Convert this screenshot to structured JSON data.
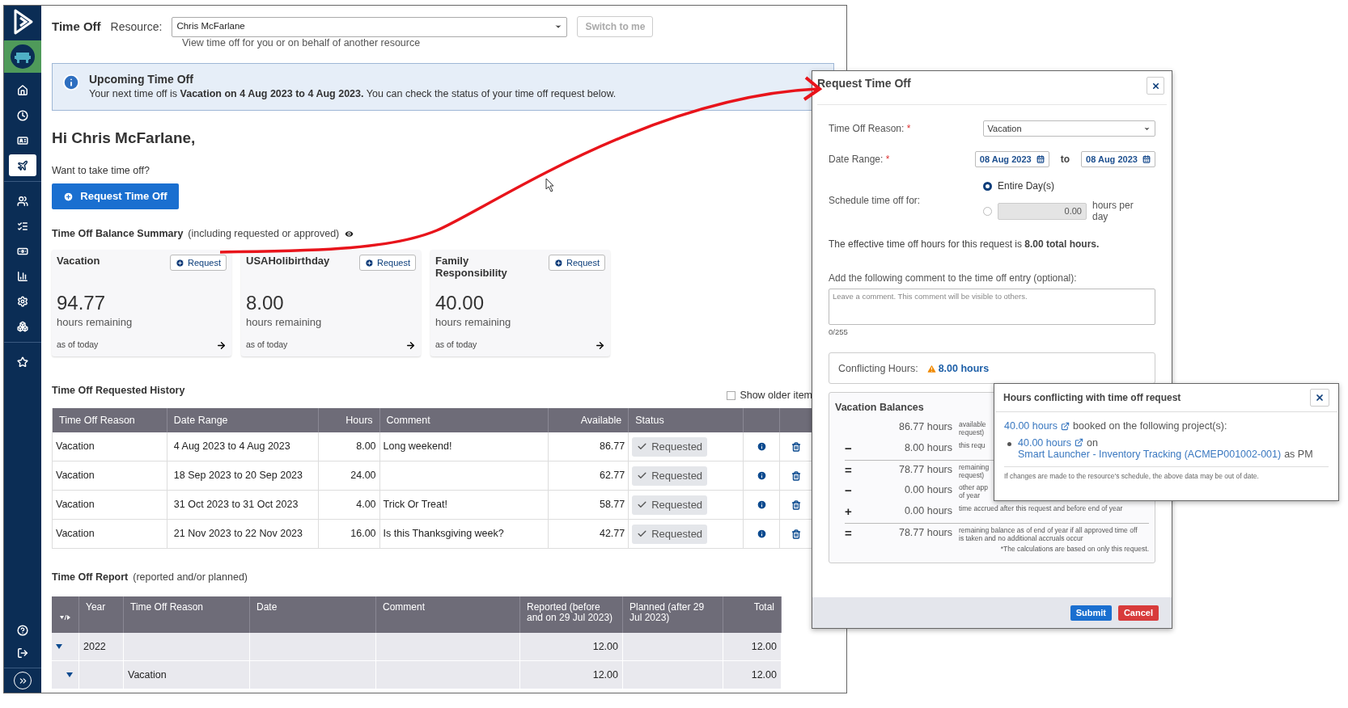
{
  "sidebar": {
    "items": [
      {
        "selected": false
      },
      {
        "selected": false
      },
      {
        "selected": false
      },
      {
        "selected": true
      },
      {
        "selected": false
      },
      {
        "selected": false
      },
      {
        "selected": false
      },
      {
        "selected": false
      },
      {
        "selected": false
      },
      {
        "selected": false
      },
      {
        "selected": false
      }
    ]
  },
  "header": {
    "title": "Time Off",
    "resource_label": "Resource:",
    "resource_value": "Chris McFarlane",
    "resource_hint": "View time off for you or on behalf of another resource",
    "switch_button": {
      "label": "Switch to me",
      "disabled": true
    }
  },
  "banner": {
    "title": "Upcoming Time Off",
    "text": "Your next time off is **Vacation on 4 Aug 2023 to 4 Aug 2023.** You can check the status of your time off request below."
  },
  "greeting": "Hi Chris McFarlane,",
  "prompt": "Want to take time off?",
  "request_button": "Request Time Off",
  "balance_summary": {
    "title": "Time Off Balance Summary",
    "note": "(including requested or approved)",
    "cards": [
      {
        "name": "Vacation",
        "request": "Request",
        "value": "94.77",
        "unit": "hours remaining",
        "as_of": "as of today"
      },
      {
        "name": "USAHolibirthday",
        "request": "Request",
        "value": "8.00",
        "unit": "hours remaining",
        "as_of": "as of today"
      },
      {
        "name": "Family Responsibility",
        "request": "Request",
        "value": "40.00",
        "unit": "hours remaining",
        "as_of": "as of today"
      }
    ]
  },
  "history": {
    "title": "Time Off Requested History",
    "show_older": {
      "label": "Show older item",
      "checked": false
    },
    "columns": [
      "Time Off Reason",
      "Date Range",
      "Hours",
      "Comment",
      "Available",
      "Status"
    ],
    "rows": [
      {
        "reason": "Vacation",
        "date_range": "4 Aug 2023 to 4 Aug 2023",
        "hours": "8.00",
        "comment": "Long weekend!",
        "available": "86.77",
        "status": "Requested"
      },
      {
        "reason": "Vacation",
        "date_range": "18 Sep 2023 to 20 Sep 2023",
        "hours": "24.00",
        "available": "62.77",
        "status": "Requested"
      },
      {
        "reason": "Vacation",
        "date_range": "31 Oct 2023 to 31 Oct 2023",
        "hours": "4.00",
        "comment": "Trick Or Treat!",
        "available": "58.77",
        "status": "Requested"
      },
      {
        "reason": "Vacation",
        "date_range": "21 Nov 2023 to 22 Nov 2023",
        "hours": "16.00",
        "comment": "Is this Thanksgiving week?",
        "available": "42.77",
        "status": "Requested"
      }
    ]
  },
  "report": {
    "title": "Time Off Report",
    "note": "(reported and/or planned)",
    "columns": [
      "Year",
      "Time Off Reason",
      "Date",
      "Comment",
      "Reported (before and on 29 Jul 2023)",
      "Planned (after 29 Jul 2023)",
      "Total"
    ],
    "rows": [
      {
        "year": "2022",
        "expanded": true,
        "reported": "12.00",
        "total": "12.00",
        "children": [
          {
            "reason": "Vacation",
            "expanded": true,
            "reported": "12.00",
            "total": "12.00"
          }
        ]
      }
    ]
  },
  "dialog": {
    "title": "Request Time Off",
    "reason_label": "Time Off Reason:",
    "required_mark": "*",
    "reason_value": "Vacation",
    "date_label": "Date Range:",
    "date_from": "08 Aug 2023",
    "date_sep": "to",
    "date_to": "08 Aug 2023",
    "schedule_label": "Schedule time off for:",
    "options": [
      {
        "kind": "days",
        "label": "Entire Day(s)",
        "selected": true
      },
      {
        "kind": "hours",
        "value": "0.00",
        "label": "hours per day",
        "selected": false
      }
    ],
    "effective": "The effective time off hours for this request is **8.00 total hours.**",
    "comment_label": "Add the following comment to the time off entry (optional):",
    "comment_placeholder": "Leave a comment. This comment will be visible to others.",
    "counter": "0/255",
    "conflict_label": "Conflicting Hours:",
    "conflict_value": "8.00 hours",
    "balances": {
      "title": "Vacation Balances",
      "rows": [
        {
          "hours": "86.77 hours",
          "desc": [
            "available",
            "request)"
          ],
          "total": false
        },
        {
          "sign": "−",
          "hours": "8.00 hours",
          "desc": [
            "this requ"
          ],
          "total": false
        },
        {
          "sign": "=",
          "hours": "78.77 hours",
          "desc": [
            "remaining",
            "request)"
          ],
          "total": true
        },
        {
          "sign": "−",
          "hours": "0.00 hours",
          "desc": [
            "other app",
            "of year"
          ],
          "total": false
        },
        {
          "sign": "+",
          "hours": "0.00 hours",
          "desc": [
            "time accrued after this request and before end of year"
          ],
          "total": false
        },
        {
          "sign": "=",
          "hours": "78.77 hours",
          "desc": [
            "remaining balance as of end of year if all approved time off is taken and no additional accruals occur"
          ],
          "total": true
        }
      ],
      "footnote": "*The calculations are based on only this request."
    },
    "submit": "Submit",
    "cancel": "Cancel"
  },
  "popup": {
    "title": "Hours conflicting with time off request",
    "summary_link": "40.00 hours",
    "summary_text": "booked on the following project(s):",
    "items": [
      {
        "hours_link": "40.00 hours",
        "on": "on",
        "project_link": "Smart Launcher - Inventory Tracking (ACMEP001002-001)",
        "role": "as PM"
      }
    ],
    "note": "If changes are made to the resource's schedule, the above data may be out of date."
  }
}
